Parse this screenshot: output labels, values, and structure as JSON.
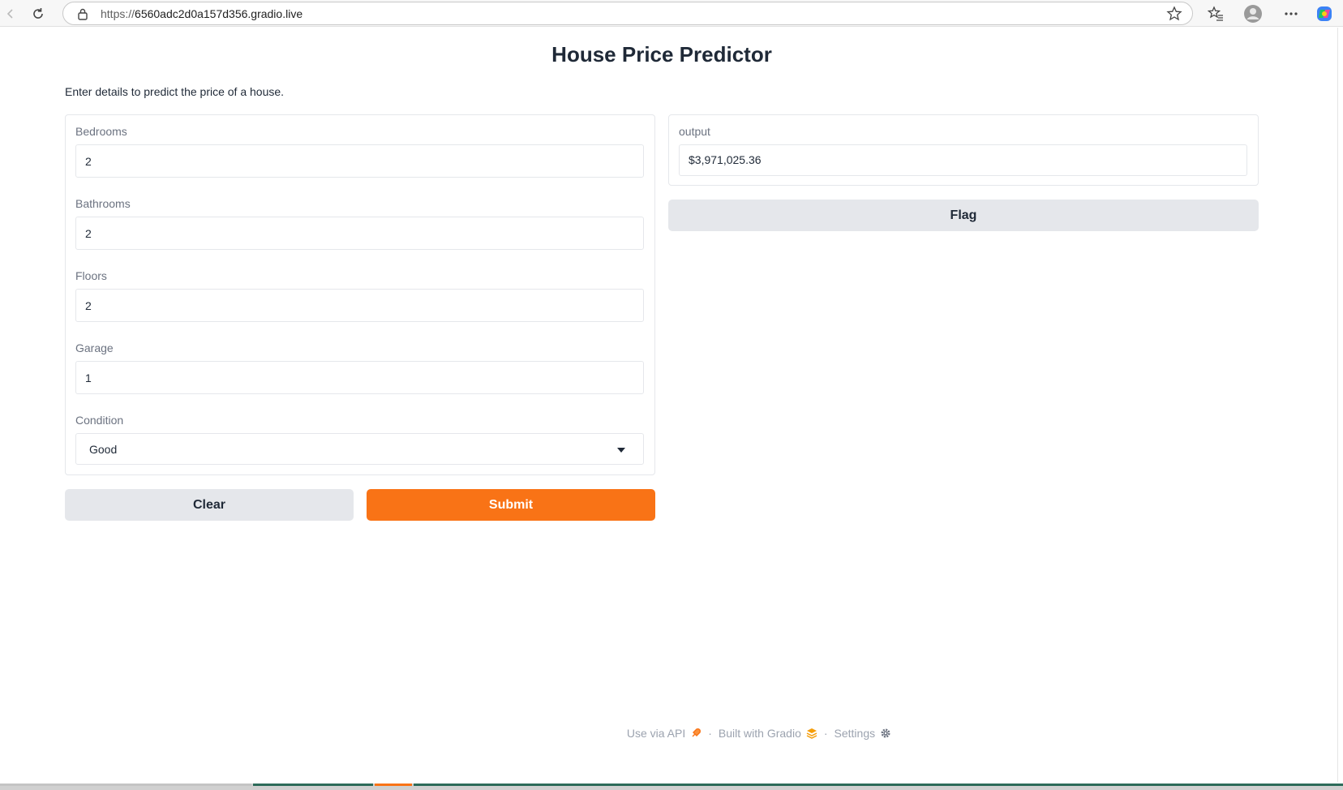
{
  "browser": {
    "url_protocol": "https://",
    "url_host": "6560adc2d0a157d356.gradio.live"
  },
  "app": {
    "title": "House Price Predictor",
    "description": "Enter details to predict the price of a house."
  },
  "inputs": {
    "bedrooms": {
      "label": "Bedrooms",
      "value": "2"
    },
    "bathrooms": {
      "label": "Bathrooms",
      "value": "2"
    },
    "floors": {
      "label": "Floors",
      "value": "2"
    },
    "garage": {
      "label": "Garage",
      "value": "1"
    },
    "condition": {
      "label": "Condition",
      "value": "Good"
    }
  },
  "output": {
    "label": "output",
    "value": "$3,971,025.36"
  },
  "buttons": {
    "clear": "Clear",
    "submit": "Submit",
    "flag": "Flag"
  },
  "footer": {
    "api": "Use via API",
    "built": "Built with Gradio",
    "settings": "Settings",
    "separator": "·"
  },
  "colors": {
    "accent": "#f97316",
    "secondary_button": "#e5e7eb"
  }
}
